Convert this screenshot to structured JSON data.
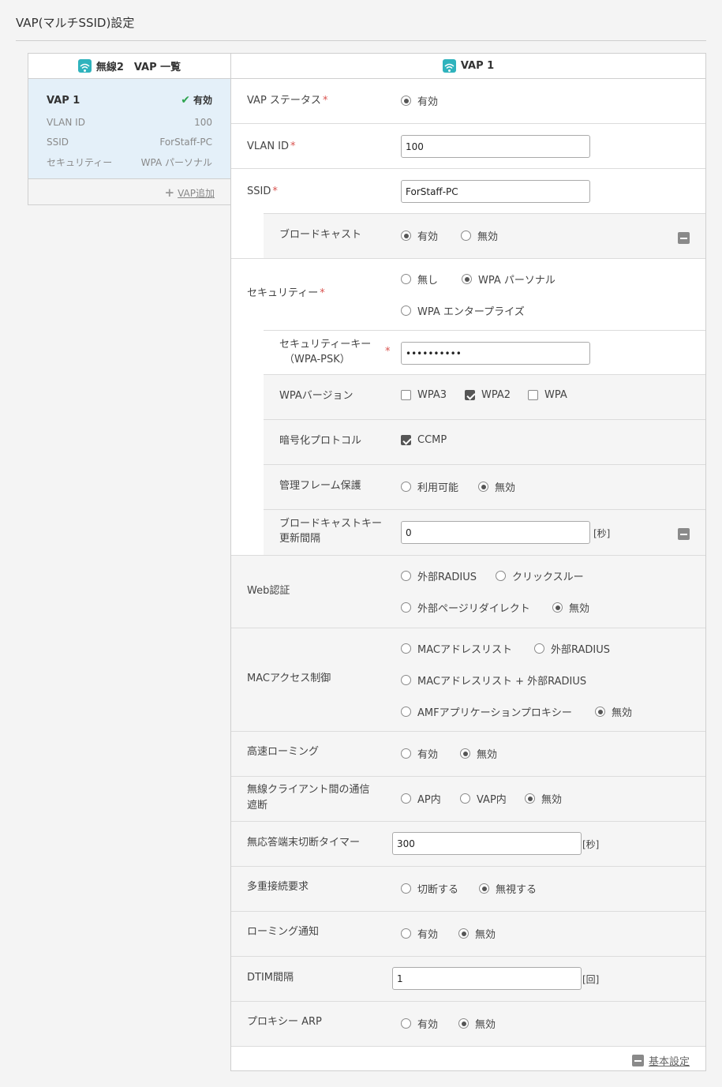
{
  "page": {
    "title": "VAP(マルチSSID)設定"
  },
  "vap_list": {
    "header": "無線2　VAP 一覧",
    "card": {
      "name": "VAP 1",
      "status": "有効",
      "rows": [
        {
          "label": "VLAN ID",
          "value": "100"
        },
        {
          "label": "SSID",
          "value": "ForStaff-PC"
        },
        {
          "label": "セキュリティー",
          "value": "WPA パーソナル"
        }
      ]
    },
    "add_label": "VAP追加"
  },
  "form": {
    "header": "VAP 1",
    "vap_status": {
      "label": "VAP ステータス",
      "options": [
        "有効"
      ]
    },
    "vlan_id": {
      "label": "VLAN ID",
      "value": "100"
    },
    "ssid": {
      "label": "SSID",
      "value": "ForStaff-PC"
    },
    "broadcast": {
      "label": "ブロードキャスト",
      "options": [
        "有効",
        "無効"
      ],
      "selected": "有効"
    },
    "security": {
      "label": "セキュリティー",
      "options": [
        "無し",
        "WPA パーソナル",
        "WPA エンタープライズ"
      ],
      "selected": "WPA パーソナル"
    },
    "security_key": {
      "label1": "セキュリティーキー",
      "label2": "（WPA-PSK）",
      "value": "••••••••••"
    },
    "wpa_version": {
      "label": "WPAバージョン",
      "options": [
        "WPA3",
        "WPA2",
        "WPA"
      ],
      "checked": [
        "WPA2"
      ]
    },
    "cipher": {
      "label": "暗号化プロトコル",
      "options": [
        "CCMP"
      ],
      "checked": [
        "CCMP"
      ]
    },
    "mgmt_frame": {
      "label": "管理フレーム保護",
      "options": [
        "利用可能",
        "無効"
      ],
      "selected": "無効"
    },
    "bcast_key": {
      "label1": "ブロードキャストキー",
      "label2": "更新間隔",
      "value": "0",
      "unit": "[秒]"
    },
    "web_auth": {
      "label": "Web認証",
      "options": [
        "外部RADIUS",
        "クリックスルー",
        "外部ページリダイレクト",
        "無効"
      ],
      "selected": "無効"
    },
    "mac_access": {
      "label": "MACアクセス制御",
      "options": [
        "MACアドレスリスト",
        "外部RADIUS",
        "MACアドレスリスト + 外部RADIUS",
        "AMFアプリケーションプロキシー",
        "無効"
      ],
      "selected": "無効"
    },
    "fast_roaming": {
      "label": "高速ローミング",
      "options": [
        "有効",
        "無効"
      ],
      "selected": "無効"
    },
    "client_isolation": {
      "label1": "無線クライアント間の通信",
      "label2": "遮断",
      "options": [
        "AP内",
        "VAP内",
        "無効"
      ],
      "selected": "無効"
    },
    "idle_timer": {
      "label": "無応答端末切断タイマー",
      "value": "300",
      "unit": "[秒]"
    },
    "multi_conn": {
      "label": "多重接続要求",
      "options": [
        "切断する",
        "無視する"
      ],
      "selected": "無視する"
    },
    "roaming_notify": {
      "label": "ローミング通知",
      "options": [
        "有効",
        "無効"
      ],
      "selected": "無効"
    },
    "dtim": {
      "label": "DTIM間隔",
      "value": "1",
      "unit": "[回]"
    },
    "proxy_arp": {
      "label": "プロキシー ARP",
      "options": [
        "有効",
        "無効"
      ],
      "selected": "無効"
    },
    "basic_settings_label": "基本設定"
  },
  "colors": {
    "accent": "#2fb3bd",
    "required": "#d9534f",
    "selected_card": "#e4f0f9",
    "success": "#2ea44f"
  }
}
